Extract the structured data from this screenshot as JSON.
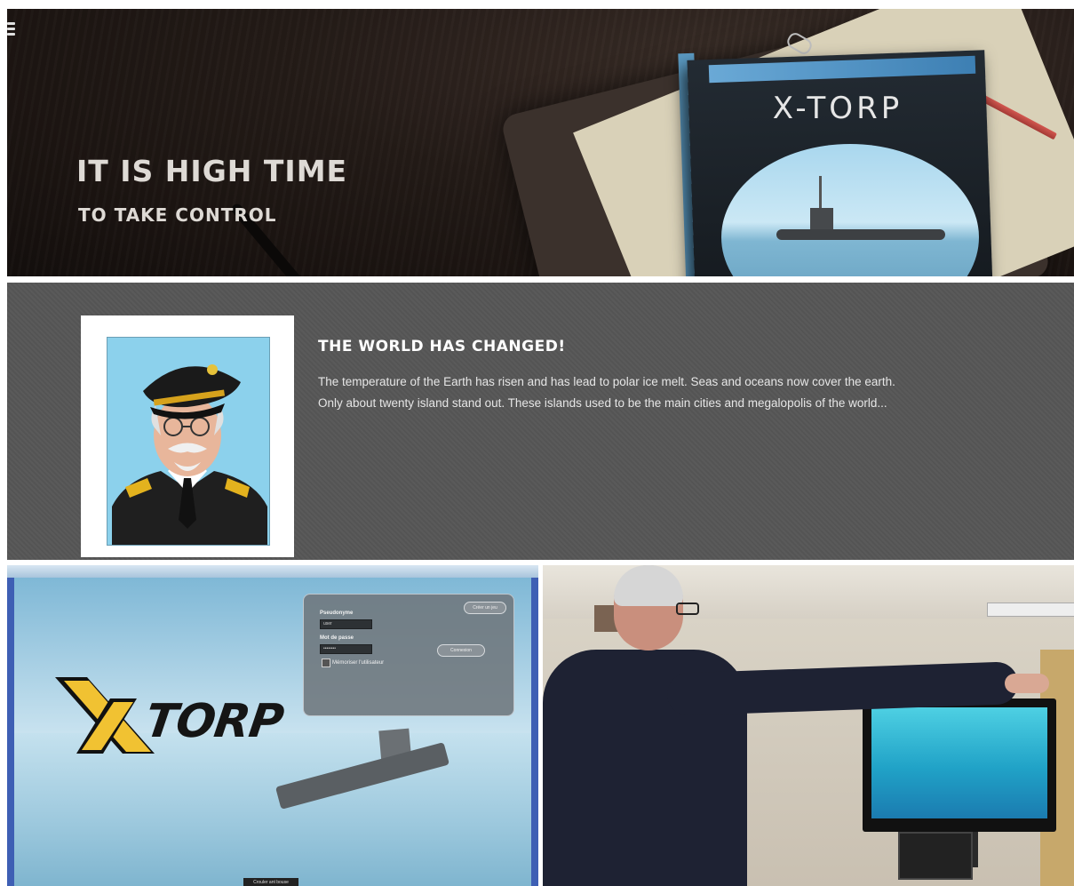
{
  "hero": {
    "title": "IT IS HIGH TIME",
    "subtitle": "TO TAKE CONTROL",
    "book_title": "X-TORP"
  },
  "story": {
    "heading": "THE WORLD HAS CHANGED!",
    "paragraph_line1": "The temperature of the Earth has risen and has lead to polar ice melt. Seas and oceans now cover the earth.",
    "paragraph_line2": "Only about twenty island stand out. These islands used to be the main cities and megalopolis of the world..."
  },
  "game_screenshot": {
    "logo_text": "TORP",
    "login": {
      "username_label": "Pseudonyme",
      "username_value": "user",
      "password_label": "Mot de passe",
      "password_value": "••••••••",
      "remember_label": "Mémoriser l'utilisateur",
      "top_button": "Créer un jeu",
      "connect_button": "Connexion"
    },
    "bottom_button": "Crouler ant bouse"
  },
  "colors": {
    "hero_bg": "#1c1613",
    "story_bg": "#575757",
    "sky": "#8cd1ec"
  }
}
